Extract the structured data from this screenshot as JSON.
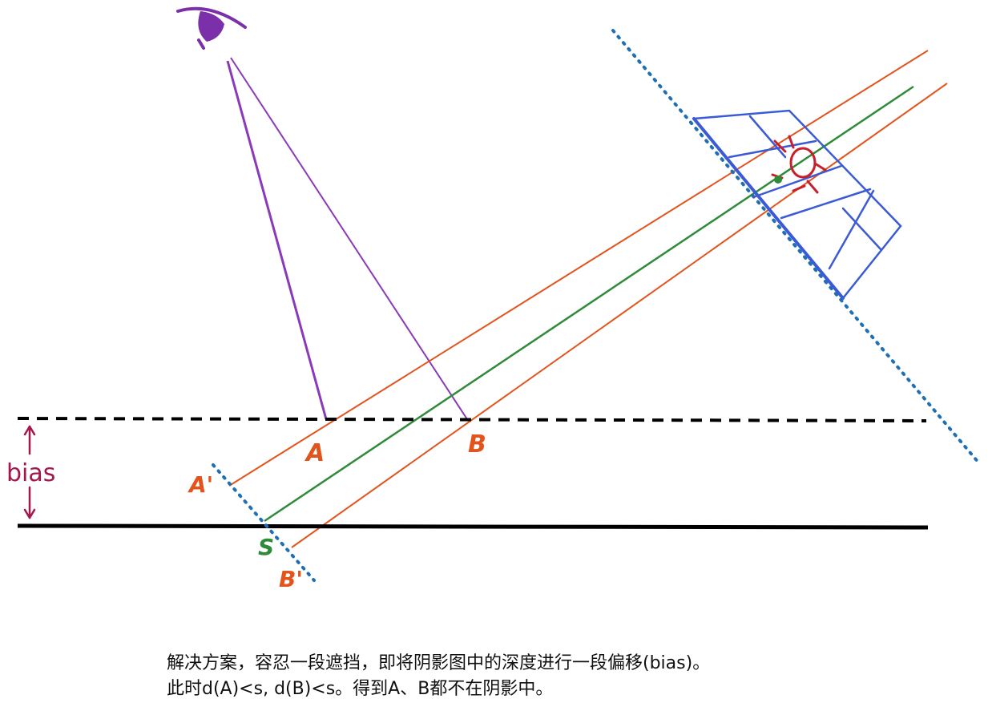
{
  "labels": {
    "A": "A",
    "B": "B",
    "A_prime": "A'",
    "B_prime": "B'",
    "S": "S",
    "bias": "bias"
  },
  "caption": {
    "line1": "解决方案，容忍一段遮挡，即将阴影图中的深度进行一段偏移(bias)。",
    "line2": "此时d(A)<s, d(B)<s。得到A、B都不在阴影中。"
  },
  "colors": {
    "eye": "#7b2fa8",
    "view_ray": "#8a3ab9",
    "light_ray": "#e2541c",
    "center_ray": "#2e8b3a",
    "shadow_plane": "#1f6fb5",
    "light_frame": "#3b5bd6",
    "light_mark": "#c8202a",
    "bias_arrow": "#a3184c",
    "surface": "#000000"
  }
}
